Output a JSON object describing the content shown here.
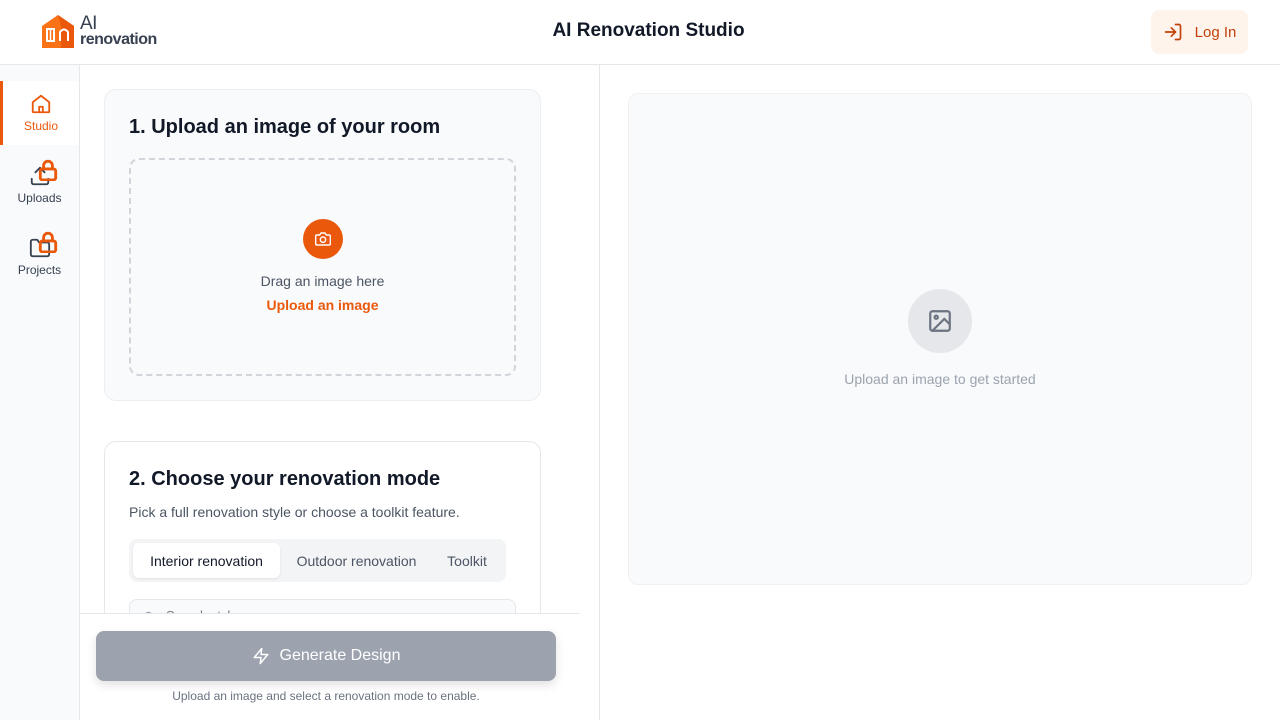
{
  "header": {
    "logo_ai": "AI",
    "logo_reno": "renovation",
    "title": "AI Renovation Studio",
    "login_label": "Log In"
  },
  "sidebar": {
    "items": [
      {
        "label": "Studio",
        "icon": "home-icon",
        "active": true
      },
      {
        "label": "Uploads",
        "icon": "upload-icon",
        "locked": true
      },
      {
        "label": "Projects",
        "icon": "folder-icon",
        "locked": true
      }
    ]
  },
  "step1": {
    "title": "1. Upload an image of your room",
    "drag_text": "Drag an image here",
    "upload_link": "Upload an image"
  },
  "step2": {
    "title": "2. Choose your renovation mode",
    "subtitle": "Pick a full renovation style or choose a toolkit feature.",
    "tabs": [
      {
        "label": "Interior renovation",
        "active": true
      },
      {
        "label": "Outdoor renovation",
        "active": false
      },
      {
        "label": "Toolkit",
        "active": false
      }
    ],
    "search_placeholder": "Search styles"
  },
  "generate": {
    "label": "Generate Design",
    "hint": "Upload an image and select a renovation mode to enable."
  },
  "preview": {
    "empty_text": "Upload an image to get started"
  },
  "colors": {
    "accent": "#ea580c",
    "disabled": "#9ca3af"
  }
}
